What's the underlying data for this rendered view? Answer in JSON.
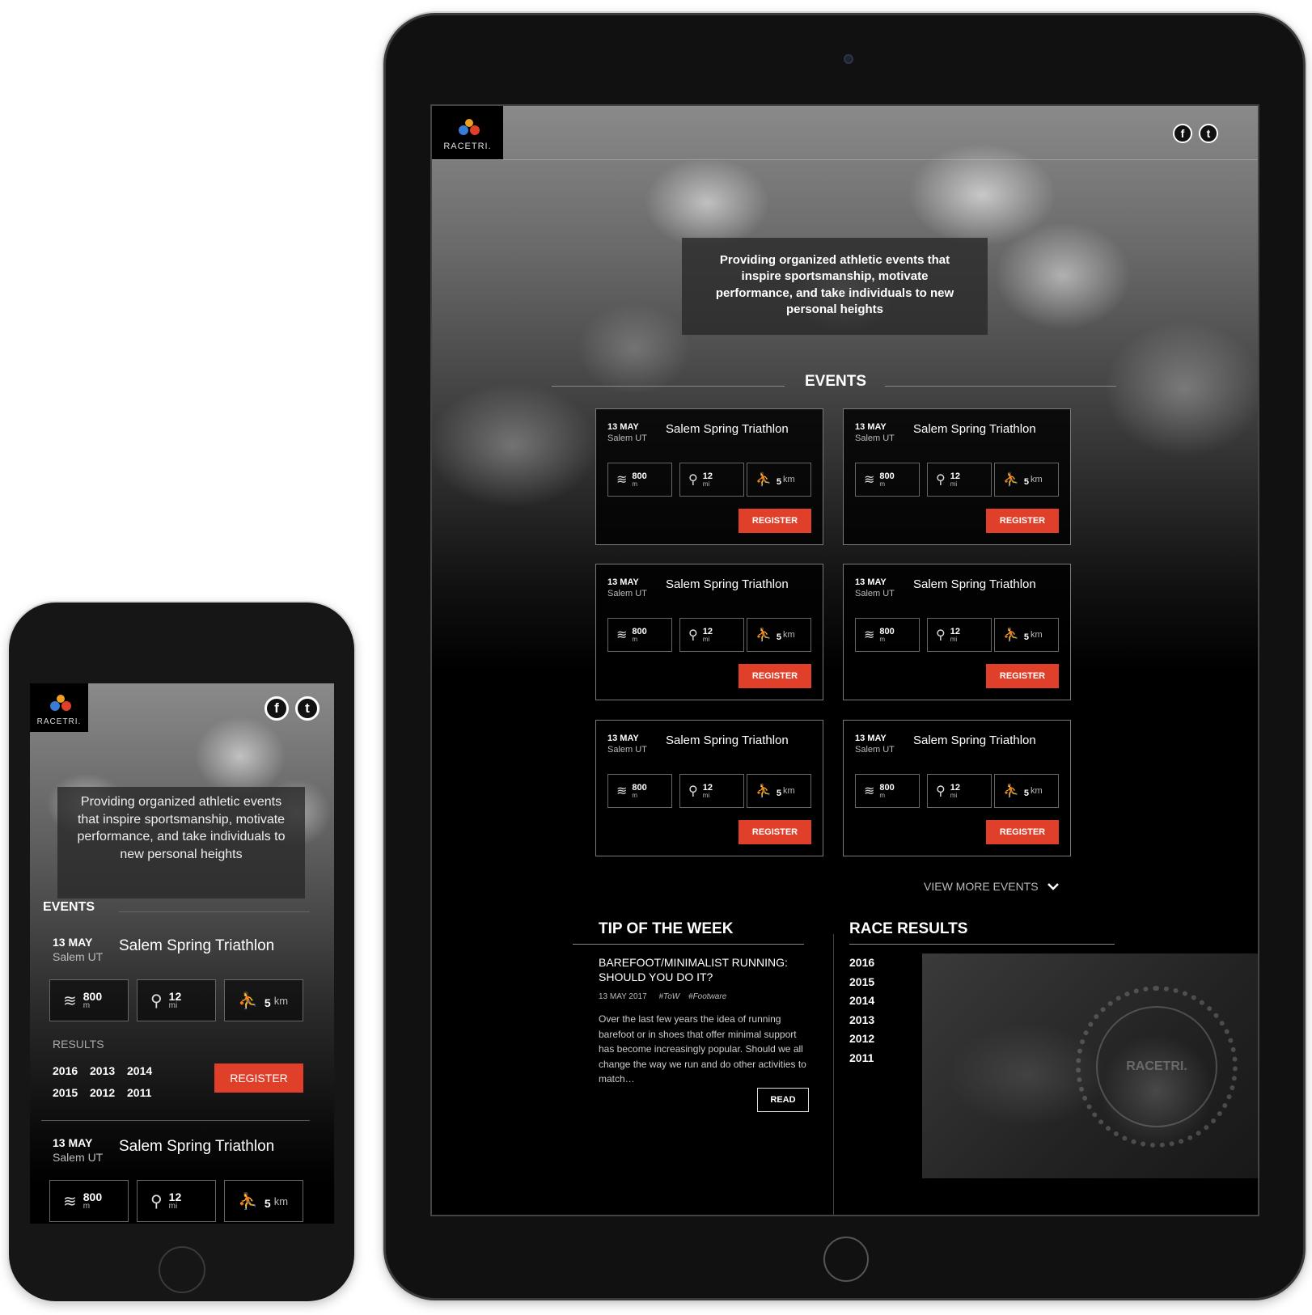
{
  "brand": {
    "logo_text": "RACETRI."
  },
  "social": {
    "facebook": "f",
    "twitter": "t"
  },
  "tagline": "Providing organized athletic events that inspire sportsmanship, motivate performance, and take individuals to new personal heights",
  "events": {
    "title": "EVENTS",
    "items": [
      {
        "date": "13 MAY",
        "location": "Salem UT",
        "name": "Salem Spring Triathlon",
        "swim_value": "800",
        "swim_unit": "m",
        "bike_value": "12",
        "bike_unit": "mi",
        "run_value": "5",
        "run_unit": "km",
        "register_label": "REGISTER"
      },
      {
        "date": "13 MAY",
        "location": "Salem UT",
        "name": "Salem Spring Triathlon",
        "swim_value": "800",
        "swim_unit": "m",
        "bike_value": "12",
        "bike_unit": "mi",
        "run_value": "5",
        "run_unit": "km",
        "register_label": "REGISTER"
      },
      {
        "date": "13 MAY",
        "location": "Salem UT",
        "name": "Salem Spring Triathlon",
        "swim_value": "800",
        "swim_unit": "m",
        "bike_value": "12",
        "bike_unit": "mi",
        "run_value": "5",
        "run_unit": "km",
        "register_label": "REGISTER"
      },
      {
        "date": "13 MAY",
        "location": "Salem UT",
        "name": "Salem Spring Triathlon",
        "swim_value": "800",
        "swim_unit": "m",
        "bike_value": "12",
        "bike_unit": "mi",
        "run_value": "5",
        "run_unit": "km",
        "register_label": "REGISTER"
      },
      {
        "date": "13 MAY",
        "location": "Salem UT",
        "name": "Salem Spring Triathlon",
        "swim_value": "800",
        "swim_unit": "m",
        "bike_value": "12",
        "bike_unit": "mi",
        "run_value": "5",
        "run_unit": "km",
        "register_label": "REGISTER"
      },
      {
        "date": "13 MAY",
        "location": "Salem UT",
        "name": "Salem Spring Triathlon",
        "swim_value": "800",
        "swim_unit": "m",
        "bike_value": "12",
        "bike_unit": "mi",
        "run_value": "5",
        "run_unit": "km",
        "register_label": "REGISTER"
      }
    ],
    "view_more_label": "VIEW MORE EVENTS"
  },
  "tip": {
    "title": "TIP OF THE WEEK",
    "headline": "BAREFOOT/MINIMALIST RUNNING: SHOULD YOU DO IT?",
    "date": "13 MAY 2017",
    "tags": [
      "#ToW",
      "#Footware"
    ],
    "body": "Over the last few years the idea of running barefoot or in shoes that offer minimal support has become increasingly popular. Should we all change the way we run and do other activities to match…",
    "read_label": "READ"
  },
  "race_results": {
    "title": "RACE RESULTS",
    "years": [
      "2016",
      "2015",
      "2014",
      "2013",
      "2012",
      "2011"
    ]
  },
  "medal": {
    "text": "RACETRI."
  },
  "mobile": {
    "results_label": "RESULTS",
    "results_years": [
      "2016",
      "2013",
      "2014",
      "2015",
      "2012",
      "2011"
    ]
  },
  "icons": {
    "swim": "swim-icon",
    "bike": "bike-icon",
    "run": "run-icon",
    "chevron": "chevron-down-icon"
  },
  "colors": {
    "accent": "#e0402a",
    "background": "#000000"
  }
}
